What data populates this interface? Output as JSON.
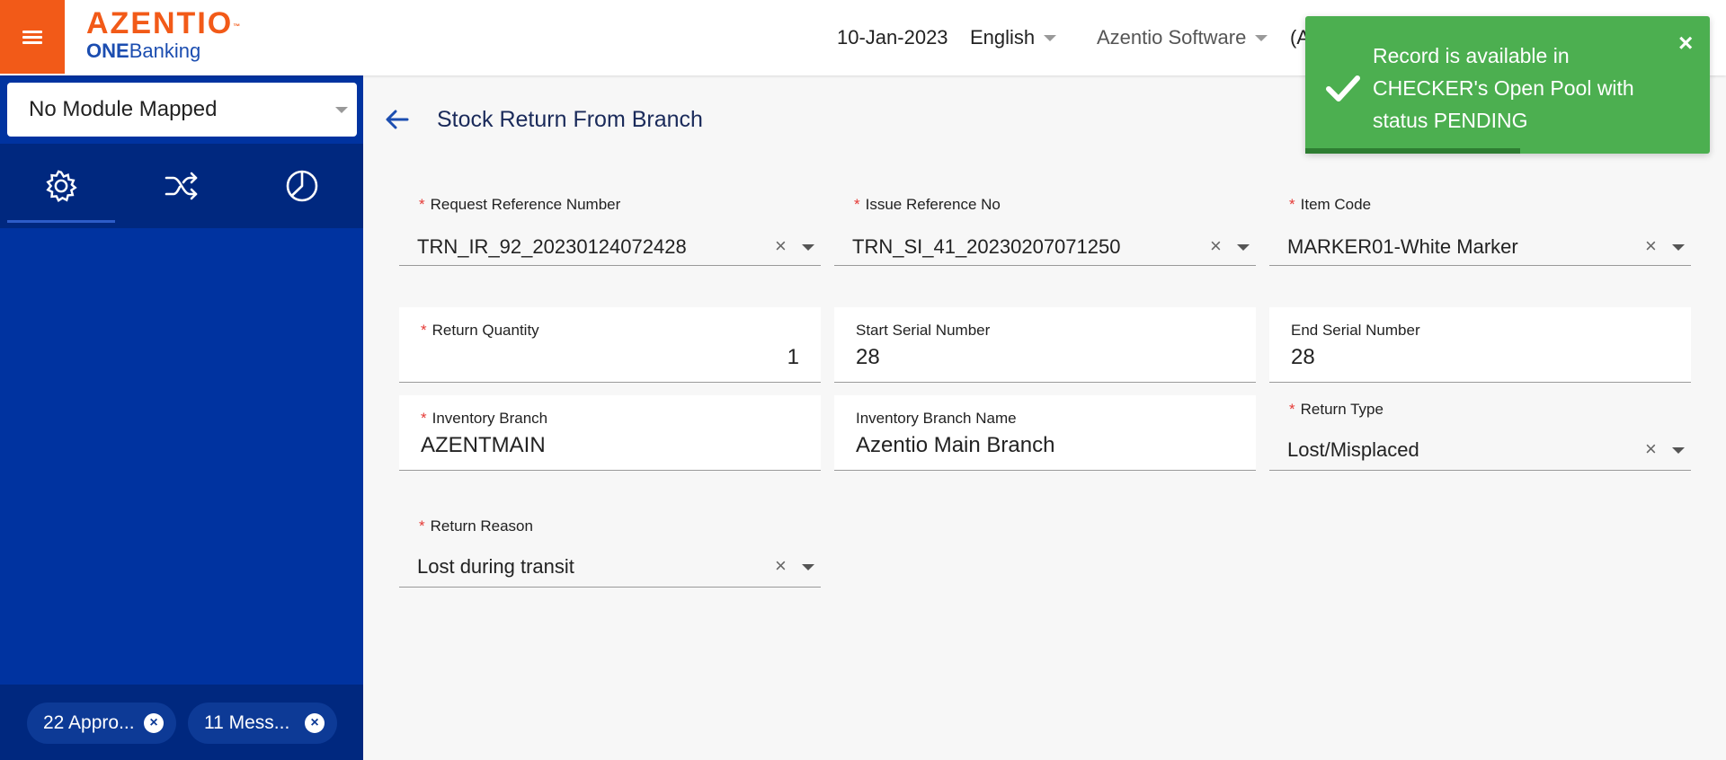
{
  "header": {
    "menu_icon": "hamburger-menu-icon",
    "logo": {
      "main": "AZENTIO",
      "tm": "™",
      "sub_bold": "ONE",
      "sub_rest": "Banking"
    },
    "date": "10-Jan-2023",
    "language": "English",
    "company": "Azentio Software",
    "user_fragment": "(A"
  },
  "sidebar": {
    "module_select": "No Module Mapped",
    "tabs": [
      {
        "icon": "gear-icon",
        "active": true
      },
      {
        "icon": "shuffle-icon",
        "active": false
      },
      {
        "icon": "pie-chart-icon",
        "active": false
      }
    ],
    "chips": [
      {
        "label": "22 Appro..."
      },
      {
        "label": "11 Mess..."
      }
    ]
  },
  "page": {
    "title": "Stock Return From Branch",
    "back_icon": "back-arrow-icon"
  },
  "form": {
    "request_ref": {
      "label": "Request Reference Number",
      "value": "TRN_IR_92_20230124072428"
    },
    "issue_ref": {
      "label": "Issue Reference No",
      "value": "TRN_SI_41_20230207071250"
    },
    "item_code": {
      "label": "Item Code",
      "value": "MARKER01-White Marker"
    },
    "return_qty": {
      "label": "Return Quantity",
      "value": "1"
    },
    "start_serial": {
      "label": "Start Serial Number",
      "value": "28"
    },
    "end_serial": {
      "label": "End Serial Number",
      "value": "28"
    },
    "inv_branch": {
      "label": "Inventory Branch",
      "value": "AZENTMAIN"
    },
    "inv_branch_name": {
      "label": "Inventory Branch Name",
      "value": "Azentio Main Branch"
    },
    "return_type": {
      "label": "Return Type",
      "value": "Lost/Misplaced"
    },
    "return_reason": {
      "label": "Return Reason",
      "value": "Lost during transit"
    },
    "required_mark": "*",
    "clear_glyph": "×"
  },
  "toast": {
    "message": "Record is available in CHECKER's Open Pool with status PENDING",
    "close": "×",
    "progress": 0.53
  },
  "colors": {
    "brand_orange": "#f25a18",
    "sidebar_blue": "#0033a0",
    "toast_green": "#4caf50"
  }
}
